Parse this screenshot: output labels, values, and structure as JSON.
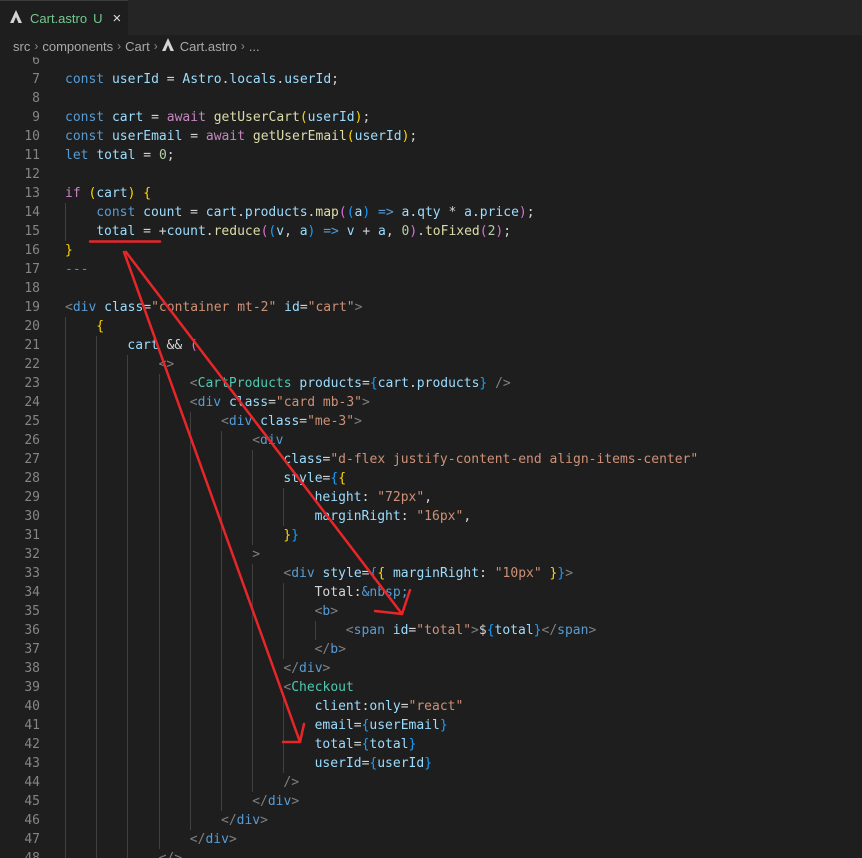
{
  "tab": {
    "file_name": "Cart.astro",
    "modified_badge": "U",
    "close_glyph": "×",
    "icon": "astro-icon"
  },
  "breadcrumb": {
    "items": [
      "src",
      "components",
      "Cart",
      "Cart.astro",
      "..."
    ],
    "separator": "›"
  },
  "editor": {
    "lines": [
      {
        "n": "6",
        "indent": 0,
        "tokens": []
      },
      {
        "n": "7",
        "indent": 0,
        "tokens": [
          [
            "kw",
            "const "
          ],
          [
            "var",
            "userId"
          ],
          [
            "txt",
            " = "
          ],
          [
            "var",
            "Astro"
          ],
          [
            "txt",
            "."
          ],
          [
            "var",
            "locals"
          ],
          [
            "txt",
            "."
          ],
          [
            "var",
            "userId"
          ],
          [
            "txt",
            ";"
          ]
        ]
      },
      {
        "n": "8",
        "indent": 0,
        "tokens": []
      },
      {
        "n": "9",
        "indent": 0,
        "tokens": [
          [
            "kw",
            "const "
          ],
          [
            "var",
            "cart"
          ],
          [
            "txt",
            " = "
          ],
          [
            "ctl",
            "await "
          ],
          [
            "fn",
            "getUserCart"
          ],
          [
            "br",
            "("
          ],
          [
            "var",
            "userId"
          ],
          [
            "br",
            ")"
          ],
          [
            "txt",
            ";"
          ]
        ]
      },
      {
        "n": "10",
        "indent": 0,
        "tokens": [
          [
            "kw",
            "const "
          ],
          [
            "var",
            "userEmail"
          ],
          [
            "txt",
            " = "
          ],
          [
            "ctl",
            "await "
          ],
          [
            "fn",
            "getUserEmail"
          ],
          [
            "br",
            "("
          ],
          [
            "var",
            "userId"
          ],
          [
            "br",
            ")"
          ],
          [
            "txt",
            ";"
          ]
        ]
      },
      {
        "n": "11",
        "indent": 0,
        "tokens": [
          [
            "kw",
            "let "
          ],
          [
            "var",
            "total"
          ],
          [
            "txt",
            " = "
          ],
          [
            "num",
            "0"
          ],
          [
            "txt",
            ";"
          ]
        ]
      },
      {
        "n": "12",
        "indent": 0,
        "tokens": []
      },
      {
        "n": "13",
        "indent": 0,
        "tokens": [
          [
            "ctl",
            "if "
          ],
          [
            "br",
            "("
          ],
          [
            "var",
            "cart"
          ],
          [
            "br",
            ")"
          ],
          [
            "txt",
            " "
          ],
          [
            "br",
            "{"
          ]
        ]
      },
      {
        "n": "14",
        "indent": 1,
        "tokens": [
          [
            "kw",
            "const "
          ],
          [
            "var",
            "count"
          ],
          [
            "txt",
            " = "
          ],
          [
            "var",
            "cart"
          ],
          [
            "txt",
            "."
          ],
          [
            "var",
            "products"
          ],
          [
            "txt",
            "."
          ],
          [
            "fn",
            "map"
          ],
          [
            "br2",
            "("
          ],
          [
            "br3",
            "("
          ],
          [
            "var",
            "a"
          ],
          [
            "br3",
            ")"
          ],
          [
            "kw",
            " => "
          ],
          [
            "var",
            "a"
          ],
          [
            "txt",
            "."
          ],
          [
            "var",
            "qty"
          ],
          [
            "txt",
            " * "
          ],
          [
            "var",
            "a"
          ],
          [
            "txt",
            "."
          ],
          [
            "var",
            "price"
          ],
          [
            "br2",
            ")"
          ],
          [
            "txt",
            ";"
          ]
        ]
      },
      {
        "n": "15",
        "indent": 1,
        "tokens": [
          [
            "var",
            "total"
          ],
          [
            "txt",
            " = +"
          ],
          [
            "var",
            "count"
          ],
          [
            "txt",
            "."
          ],
          [
            "fn",
            "reduce"
          ],
          [
            "br2",
            "("
          ],
          [
            "br3",
            "("
          ],
          [
            "var",
            "v"
          ],
          [
            "txt",
            ", "
          ],
          [
            "var",
            "a"
          ],
          [
            "br3",
            ")"
          ],
          [
            "kw",
            " => "
          ],
          [
            "var",
            "v"
          ],
          [
            "txt",
            " + "
          ],
          [
            "var",
            "a"
          ],
          [
            "txt",
            ", "
          ],
          [
            "num",
            "0"
          ],
          [
            "br2",
            ")"
          ],
          [
            "txt",
            "."
          ],
          [
            "fn",
            "toFixed"
          ],
          [
            "br2",
            "("
          ],
          [
            "num",
            "2"
          ],
          [
            "br2",
            ")"
          ],
          [
            "txt",
            ";"
          ]
        ]
      },
      {
        "n": "16",
        "indent": 0,
        "tokens": [
          [
            "br",
            "}"
          ]
        ]
      },
      {
        "n": "17",
        "indent": 0,
        "tokens": [
          [
            "dash",
            "---"
          ]
        ]
      },
      {
        "n": "18",
        "indent": 0,
        "tokens": []
      },
      {
        "n": "19",
        "indent": 0,
        "tokens": [
          [
            "dash",
            "<"
          ],
          [
            "tag",
            "div "
          ],
          [
            "attr",
            "class"
          ],
          [
            "txt",
            "="
          ],
          [
            "str",
            "\"container mt-2\""
          ],
          [
            "txt",
            " "
          ],
          [
            "attr",
            "id"
          ],
          [
            "txt",
            "="
          ],
          [
            "str",
            "\"cart\""
          ],
          [
            "dash",
            ">"
          ]
        ]
      },
      {
        "n": "20",
        "indent": 1,
        "tokens": [
          [
            "br",
            "{"
          ]
        ]
      },
      {
        "n": "21",
        "indent": 2,
        "tokens": [
          [
            "var",
            "cart"
          ],
          [
            "txt",
            " && "
          ],
          [
            "br2",
            "("
          ]
        ]
      },
      {
        "n": "22",
        "indent": 3,
        "tokens": [
          [
            "dash",
            "<>"
          ]
        ]
      },
      {
        "n": "23",
        "indent": 4,
        "tokens": [
          [
            "dash",
            "<"
          ],
          [
            "comp",
            "CartProducts "
          ],
          [
            "attr",
            "products"
          ],
          [
            "txt",
            "="
          ],
          [
            "br3",
            "{"
          ],
          [
            "var",
            "cart"
          ],
          [
            "txt",
            "."
          ],
          [
            "var",
            "products"
          ],
          [
            "br3",
            "}"
          ],
          [
            "txt",
            " "
          ],
          [
            "dash",
            "/>"
          ]
        ]
      },
      {
        "n": "24",
        "indent": 4,
        "tokens": [
          [
            "dash",
            "<"
          ],
          [
            "tag",
            "div "
          ],
          [
            "attr",
            "class"
          ],
          [
            "txt",
            "="
          ],
          [
            "str",
            "\"card mb-3\""
          ],
          [
            "dash",
            ">"
          ]
        ]
      },
      {
        "n": "25",
        "indent": 5,
        "tokens": [
          [
            "dash",
            "<"
          ],
          [
            "tag",
            "div "
          ],
          [
            "attr",
            "class"
          ],
          [
            "txt",
            "="
          ],
          [
            "str",
            "\"me-3\""
          ],
          [
            "dash",
            ">"
          ]
        ]
      },
      {
        "n": "26",
        "indent": 6,
        "tokens": [
          [
            "dash",
            "<"
          ],
          [
            "tag",
            "div"
          ]
        ]
      },
      {
        "n": "27",
        "indent": 7,
        "tokens": [
          [
            "attr",
            "class"
          ],
          [
            "txt",
            "="
          ],
          [
            "str",
            "\"d-flex justify-content-end align-items-center\""
          ]
        ]
      },
      {
        "n": "28",
        "indent": 7,
        "tokens": [
          [
            "attr",
            "style"
          ],
          [
            "txt",
            "="
          ],
          [
            "br3",
            "{"
          ],
          [
            "br",
            "{"
          ]
        ]
      },
      {
        "n": "29",
        "indent": 8,
        "tokens": [
          [
            "var",
            "height"
          ],
          [
            "txt",
            ": "
          ],
          [
            "str",
            "\"72px\""
          ],
          [
            "txt",
            ","
          ]
        ]
      },
      {
        "n": "30",
        "indent": 8,
        "tokens": [
          [
            "var",
            "marginRight"
          ],
          [
            "txt",
            ": "
          ],
          [
            "str",
            "\"16px\""
          ],
          [
            "txt",
            ","
          ]
        ]
      },
      {
        "n": "31",
        "indent": 7,
        "tokens": [
          [
            "br",
            "}"
          ],
          [
            "br3",
            "}"
          ]
        ]
      },
      {
        "n": "32",
        "indent": 6,
        "tokens": [
          [
            "dash",
            ">"
          ]
        ]
      },
      {
        "n": "33",
        "indent": 7,
        "tokens": [
          [
            "dash",
            "<"
          ],
          [
            "tag",
            "div "
          ],
          [
            "attr",
            "style"
          ],
          [
            "txt",
            "="
          ],
          [
            "br3",
            "{"
          ],
          [
            "br",
            "{"
          ],
          [
            "txt",
            " "
          ],
          [
            "var",
            "marginRight"
          ],
          [
            "txt",
            ": "
          ],
          [
            "str",
            "\"10px\""
          ],
          [
            "txt",
            " "
          ],
          [
            "br",
            "}"
          ],
          [
            "br3",
            "}"
          ],
          [
            "dash",
            ">"
          ]
        ]
      },
      {
        "n": "34",
        "indent": 8,
        "tokens": [
          [
            "txt",
            "Total:"
          ],
          [
            "kw",
            "&nbsp;"
          ]
        ]
      },
      {
        "n": "35",
        "indent": 8,
        "tokens": [
          [
            "dash",
            "<"
          ],
          [
            "tag",
            "b"
          ],
          [
            "dash",
            ">"
          ]
        ]
      },
      {
        "n": "36",
        "indent": 9,
        "tokens": [
          [
            "dash",
            "<"
          ],
          [
            "tag",
            "span "
          ],
          [
            "attr",
            "id"
          ],
          [
            "txt",
            "="
          ],
          [
            "str",
            "\"total\""
          ],
          [
            "dash",
            ">"
          ],
          [
            "txt",
            "$"
          ],
          [
            "br3",
            "{"
          ],
          [
            "var",
            "total"
          ],
          [
            "br3",
            "}"
          ],
          [
            "dash",
            "</"
          ],
          [
            "tag",
            "span"
          ],
          [
            "dash",
            ">"
          ]
        ]
      },
      {
        "n": "37",
        "indent": 8,
        "tokens": [
          [
            "dash",
            "</"
          ],
          [
            "tag",
            "b"
          ],
          [
            "dash",
            ">"
          ]
        ]
      },
      {
        "n": "38",
        "indent": 7,
        "tokens": [
          [
            "dash",
            "</"
          ],
          [
            "tag",
            "div"
          ],
          [
            "dash",
            ">"
          ]
        ]
      },
      {
        "n": "39",
        "indent": 7,
        "tokens": [
          [
            "dash",
            "<"
          ],
          [
            "comp",
            "Checkout"
          ]
        ]
      },
      {
        "n": "40",
        "indent": 8,
        "tokens": [
          [
            "attr",
            "client"
          ],
          [
            "txt",
            ":"
          ],
          [
            "attr",
            "only"
          ],
          [
            "txt",
            "="
          ],
          [
            "str",
            "\"react\""
          ]
        ]
      },
      {
        "n": "41",
        "indent": 8,
        "tokens": [
          [
            "attr",
            "email"
          ],
          [
            "txt",
            "="
          ],
          [
            "br3",
            "{"
          ],
          [
            "var",
            "userEmail"
          ],
          [
            "br3",
            "}"
          ]
        ]
      },
      {
        "n": "42",
        "indent": 8,
        "tokens": [
          [
            "attr",
            "total"
          ],
          [
            "txt",
            "="
          ],
          [
            "br3",
            "{"
          ],
          [
            "var",
            "total"
          ],
          [
            "br3",
            "}"
          ]
        ]
      },
      {
        "n": "43",
        "indent": 8,
        "tokens": [
          [
            "attr",
            "userId"
          ],
          [
            "txt",
            "="
          ],
          [
            "br3",
            "{"
          ],
          [
            "var",
            "userId"
          ],
          [
            "br3",
            "}"
          ]
        ]
      },
      {
        "n": "44",
        "indent": 7,
        "tokens": [
          [
            "dash",
            "/>"
          ]
        ]
      },
      {
        "n": "45",
        "indent": 6,
        "tokens": [
          [
            "dash",
            "</"
          ],
          [
            "tag",
            "div"
          ],
          [
            "dash",
            ">"
          ]
        ]
      },
      {
        "n": "46",
        "indent": 5,
        "tokens": [
          [
            "dash",
            "</"
          ],
          [
            "tag",
            "div"
          ],
          [
            "dash",
            ">"
          ]
        ]
      },
      {
        "n": "47",
        "indent": 4,
        "tokens": [
          [
            "dash",
            "</"
          ],
          [
            "tag",
            "div"
          ],
          [
            "dash",
            ">"
          ]
        ]
      },
      {
        "n": "48",
        "indent": 3,
        "tokens": [
          [
            "dash",
            "</>"
          ]
        ]
      }
    ]
  },
  "annotation": {
    "color": "#e8262a"
  }
}
